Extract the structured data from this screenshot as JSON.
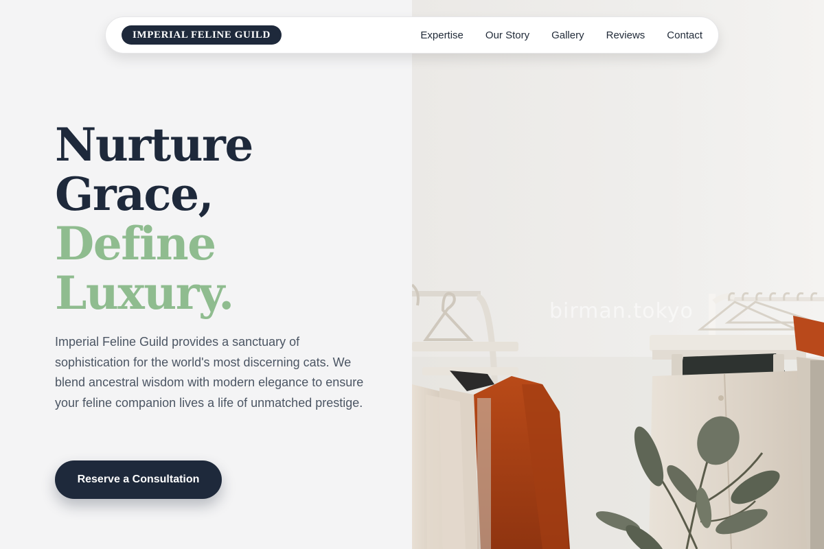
{
  "nav": {
    "brand": "IMPERIAL FELINE GUILD",
    "links": [
      "Expertise",
      "Our Story",
      "Gallery",
      "Reviews",
      "Contact"
    ]
  },
  "hero": {
    "headline_dark_1": "Nurture",
    "headline_dark_2": "Grace,",
    "headline_green_1": "Define",
    "headline_green_2": "Luxury.",
    "description": "Imperial Feline Guild provides a sanctuary of sophistication for the world's most discerning cats. We blend ancestral wisdom with modern elegance to ensure your feline companion lives a life of unmatched prestige.",
    "cta_label": "Reserve a Consultation"
  },
  "image": {
    "watermark": "birman.tokyo"
  },
  "colors": {
    "primary": "#1e293b",
    "accent_green": "#8fbc8f",
    "background": "#f4f4f5"
  }
}
